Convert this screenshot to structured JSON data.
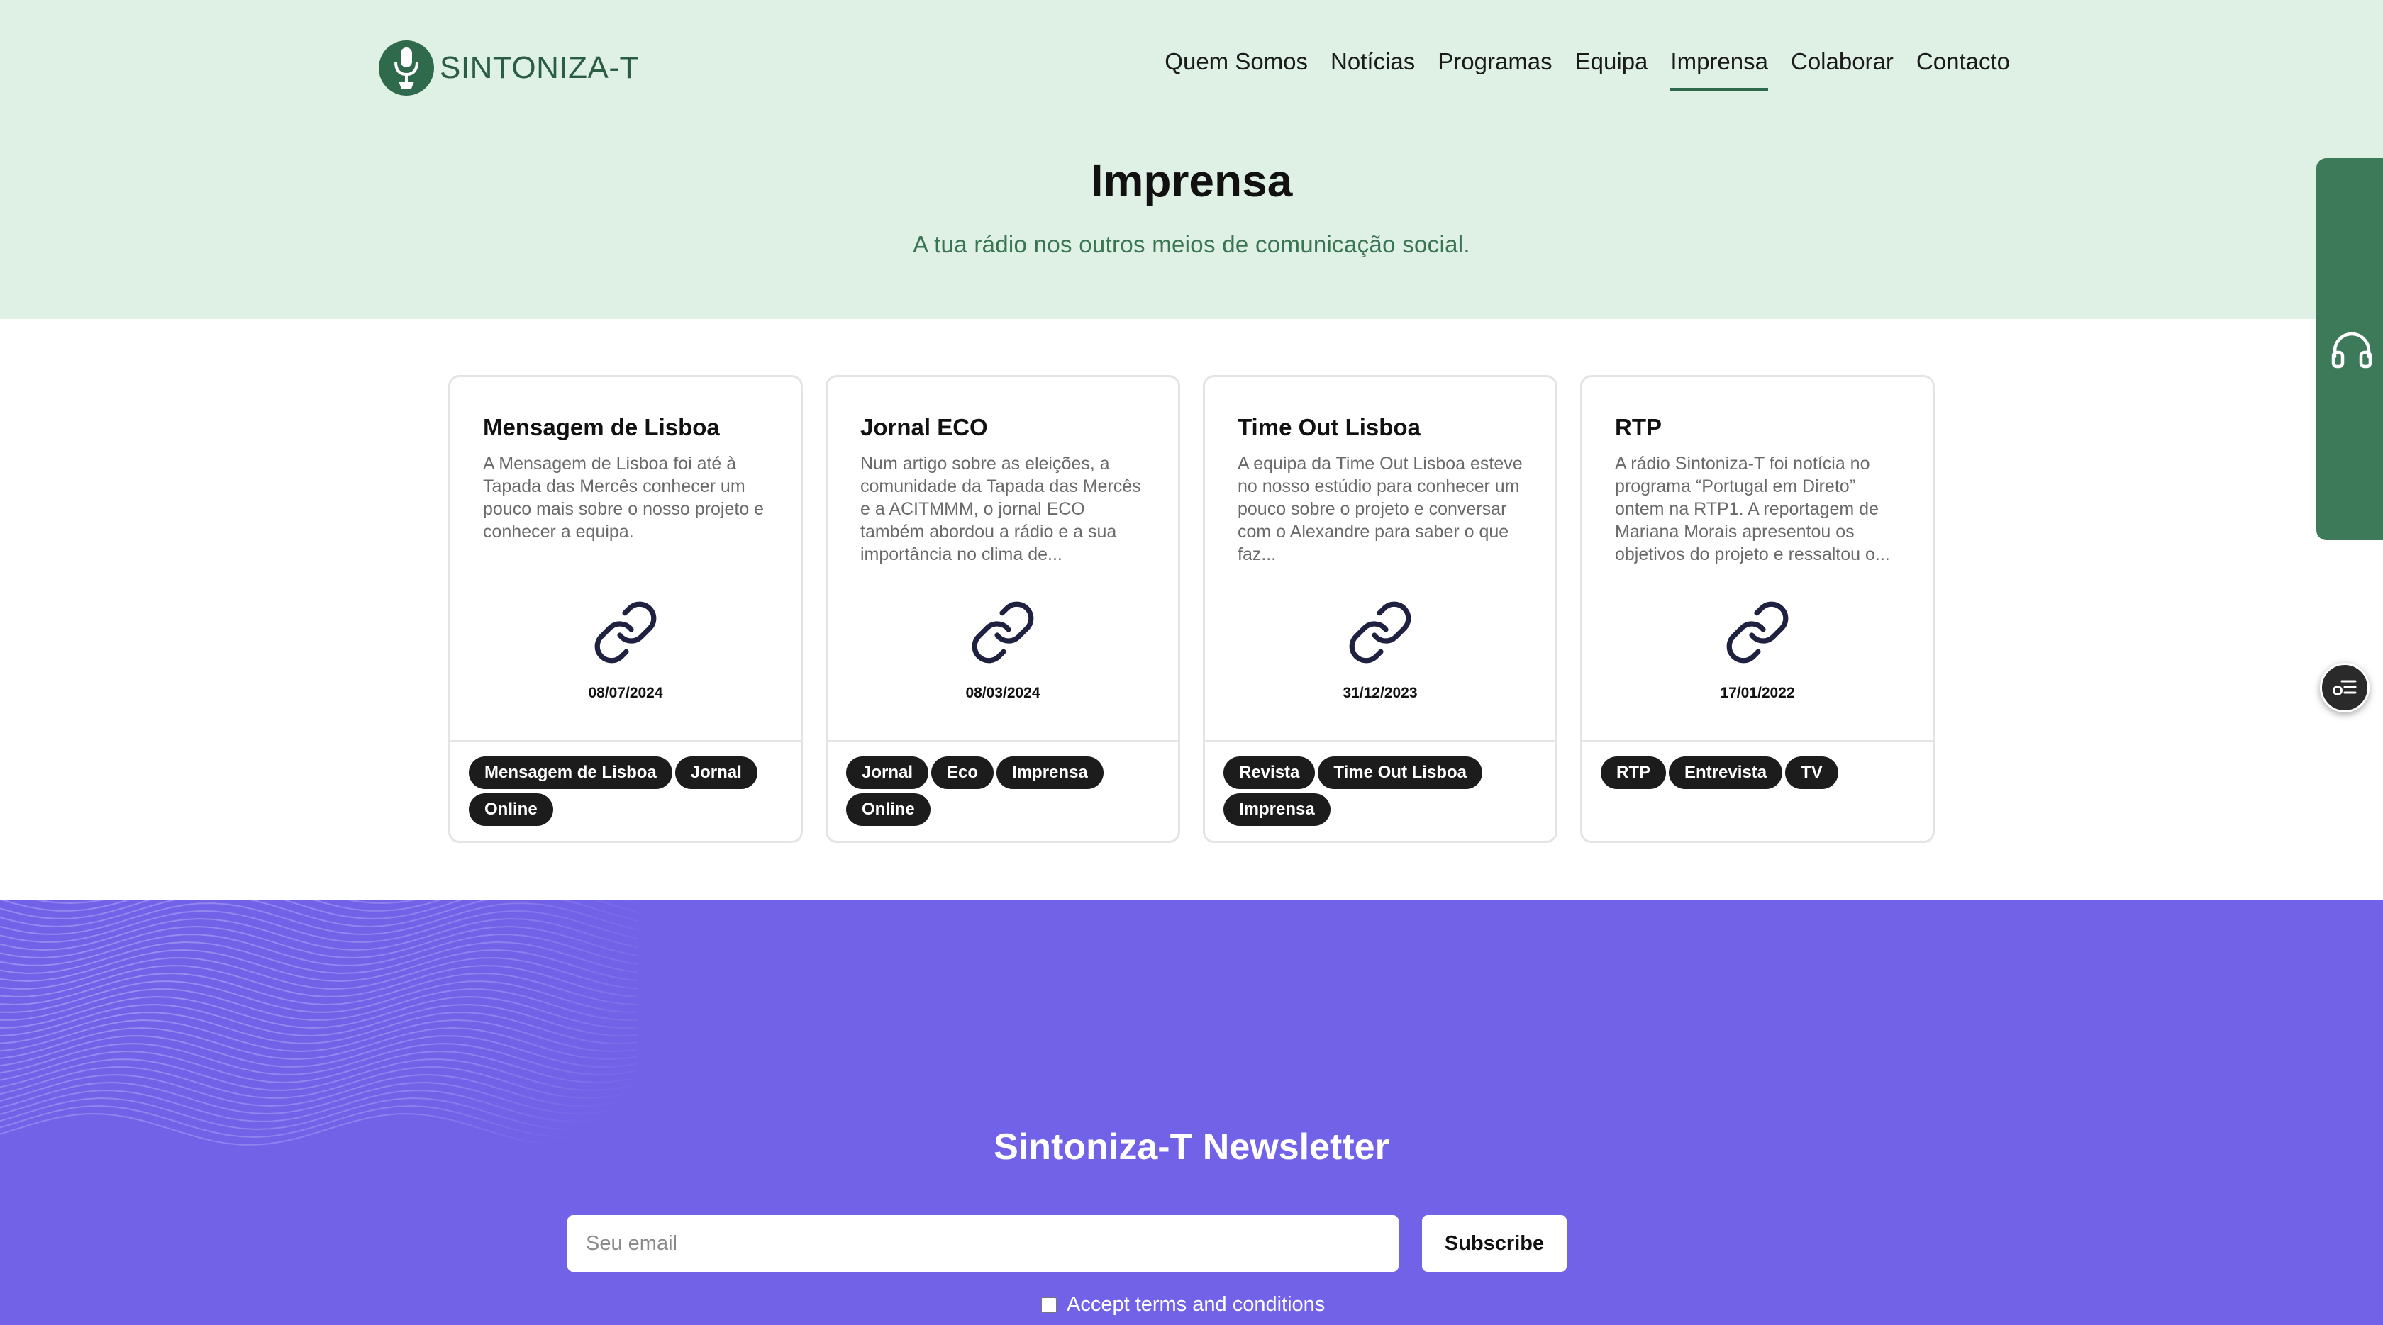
{
  "brand": {
    "name": "SINTONIZA-T",
    "color": "#2f6a4c"
  },
  "nav": {
    "items": [
      {
        "label": "Quem Somos",
        "active": false
      },
      {
        "label": "Notícias",
        "active": false
      },
      {
        "label": "Programas",
        "active": false
      },
      {
        "label": "Equipa",
        "active": false
      },
      {
        "label": "Imprensa",
        "active": true
      },
      {
        "label": "Colaborar",
        "active": false
      },
      {
        "label": "Contacto",
        "active": false
      }
    ]
  },
  "hero": {
    "title": "Imprensa",
    "subtitle": "A tua rádio nos outros meios de comunicação social."
  },
  "cards": [
    {
      "title": "Mensagem de Lisboa",
      "text": "A Mensagem de Lisboa foi até à Tapada das Mercês conhecer um pouco mais sobre o nosso projeto e conhecer a equipa.",
      "date": "08/07/2024",
      "icon": "link-icon",
      "tags": [
        "Mensagem de Lisboa",
        "Jornal",
        "Online"
      ]
    },
    {
      "title": "Jornal ECO",
      "text": "Num artigo sobre as eleições, a comunidade da Tapada das Mercês e a ACITMMM, o jornal ECO também abordou a rádio e a sua importância no clima de...",
      "date": "08/03/2024",
      "icon": "link-icon",
      "tags": [
        "Jornal",
        "Eco",
        "Imprensa",
        "Online"
      ]
    },
    {
      "title": "Time Out Lisboa",
      "text": "A equipa da Time Out Lisboa esteve no nosso estúdio para conhecer um pouco sobre o projeto e conversar com o Alexandre para saber o que faz...",
      "date": "31/12/2023",
      "icon": "link-icon",
      "tags": [
        "Revista",
        "Time Out Lisboa",
        "Imprensa"
      ]
    },
    {
      "title": "RTP",
      "text": "A rádio Sintoniza-T foi notícia no programa “Portugal em Direto” ontem na RTP1. A reportagem de Mariana Morais apresentou os objetivos do projeto e ressaltou o...",
      "date": "17/01/2022",
      "icon": "link-icon",
      "tags": [
        "RTP",
        "Entrevista",
        "TV"
      ]
    }
  ],
  "side": {
    "player_icon": "headphones-icon",
    "accessibility_icon": "accessibility-icon"
  },
  "newsletter": {
    "title": "Sintoniza-T Newsletter",
    "email_placeholder": "Seu email",
    "subscribe_label": "Subscribe",
    "terms_label": "Accept terms and conditions"
  },
  "colors": {
    "hero_bg": "#dff0e5",
    "accent_green": "#3d7a59",
    "newsletter_bg": "#7262e8",
    "tag_bg": "#1c1c1c"
  }
}
